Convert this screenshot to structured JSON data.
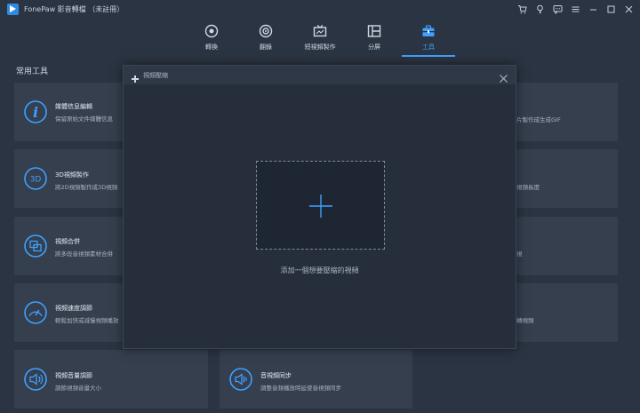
{
  "app": {
    "title": "FonePaw 影音轉檔 （未註冊）"
  },
  "nav": {
    "tabs": [
      {
        "label": "轉換",
        "icon": "convert-icon"
      },
      {
        "label": "翻錄",
        "icon": "rip-disc-icon"
      },
      {
        "label": "短視頻製作",
        "icon": "mv-icon"
      },
      {
        "label": "分屏",
        "icon": "collage-icon"
      },
      {
        "label": "工具",
        "icon": "toolbox-icon",
        "active": true
      }
    ]
  },
  "tools": {
    "section_title": "常用工具",
    "left": [
      {
        "title": "媒體信息編輯",
        "desc": "保留原始文件媒體信息",
        "icon": "info-icon"
      },
      {
        "title": "3D視頻製作",
        "desc": "將2D視頻製作成3D視頻",
        "icon": "3d-icon"
      },
      {
        "title": "視頻合併",
        "desc": "將多段音視頻素材合併",
        "icon": "merge-icon"
      },
      {
        "title": "視頻速度調節",
        "desc": "輕鬆加快或減慢視頻播放",
        "icon": "speedometer-icon"
      },
      {
        "title": "視頻音量調節",
        "desc": "調節視頻音量大小",
        "icon": "volume-icon"
      }
    ],
    "middle": [
      {
        "title": "音視頻同步",
        "desc": "調整音頻播放時延使音視頻同步",
        "icon": "av-sync-icon"
      }
    ],
    "right_partial": [
      "片製作成生成GIF",
      "視頻長度",
      "視",
      "轉視頻"
    ]
  },
  "modal": {
    "title": "視頻壓縮",
    "drop_hint": "添加一個想要壓縮的視頻"
  },
  "colors": {
    "accent": "#3fa0ff",
    "bg": "#2b3442",
    "card": "#353f4e",
    "modal": "#262e3b"
  }
}
